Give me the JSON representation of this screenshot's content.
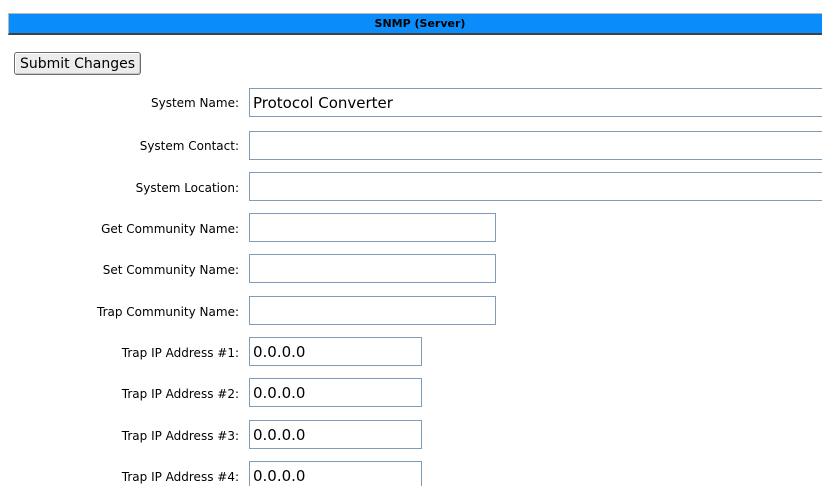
{
  "header": {
    "title": "SNMP (Server)"
  },
  "actions": {
    "submit_label": "Submit Changes"
  },
  "form": {
    "system_name": {
      "label": "System Name:",
      "value": "Protocol Converter"
    },
    "system_contact": {
      "label": "System Contact:",
      "value": ""
    },
    "system_location": {
      "label": "System Location:",
      "value": ""
    },
    "get_community": {
      "label": "Get Community Name:",
      "value": ""
    },
    "set_community": {
      "label": "Set Community Name:",
      "value": ""
    },
    "trap_community": {
      "label": "Trap Community Name:",
      "value": ""
    },
    "trap_ip_1": {
      "label": "Trap IP Address #1:",
      "value": "0.0.0.0"
    },
    "trap_ip_2": {
      "label": "Trap IP Address #2:",
      "value": "0.0.0.0"
    },
    "trap_ip_3": {
      "label": "Trap IP Address #3:",
      "value": "0.0.0.0"
    },
    "trap_ip_4": {
      "label": "Trap IP Address #4:",
      "value": "0.0.0.0"
    }
  },
  "colors": {
    "title_bar": "#0a8cfa",
    "input_border": "#7f9db9"
  }
}
